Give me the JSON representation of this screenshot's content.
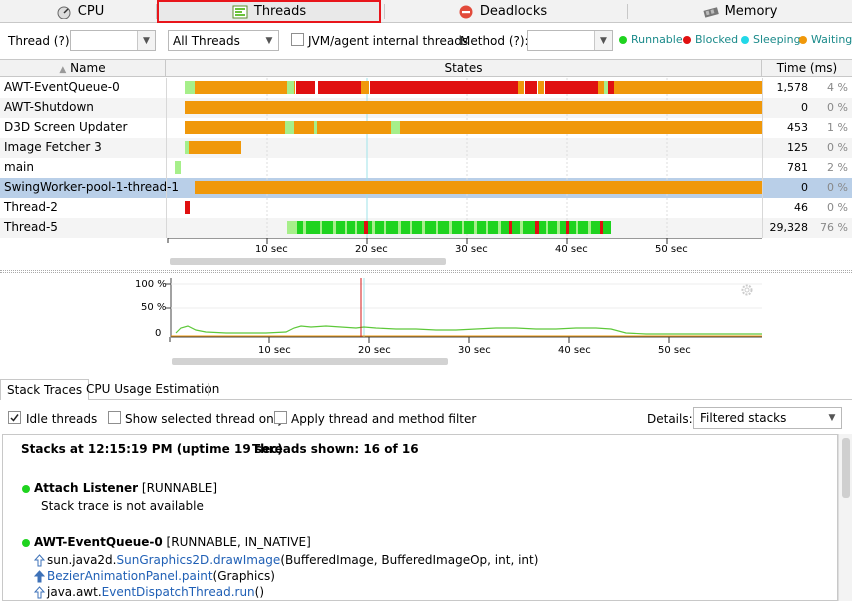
{
  "tabs": [
    {
      "label": "CPU",
      "icon": "cpu-gauge-icon"
    },
    {
      "label": "Threads",
      "icon": "threads-icon",
      "selected": true
    },
    {
      "label": "Deadlocks",
      "icon": "no-entry-icon"
    },
    {
      "label": "Memory",
      "icon": "memory-chip-icon"
    }
  ],
  "filters": {
    "thread_label": "Thread (?):",
    "thread_value": "",
    "scope_value": "All Threads",
    "internal_label": "JVM/agent internal threads",
    "method_label": "Method (?):",
    "method_value": ""
  },
  "legend": [
    {
      "label": "Runnable",
      "color": "#1fd31f"
    },
    {
      "label": "Blocked",
      "color": "#e01010"
    },
    {
      "label": "Sleeping",
      "color": "#22d8e8"
    },
    {
      "label": "Waiting",
      "color": "#f0980a"
    }
  ],
  "table": {
    "headers": {
      "name": "Name",
      "states": "States",
      "time": "Time (ms)"
    },
    "axis_labels": [
      "10 sec",
      "20 sec",
      "30 sec",
      "40 sec",
      "50 sec"
    ],
    "rows": [
      {
        "name": "AWT-EventQueue-0",
        "time": "1,578",
        "pct": "4 %"
      },
      {
        "name": "AWT-Shutdown",
        "time": "0",
        "pct": "0 %"
      },
      {
        "name": "D3D Screen Updater",
        "time": "453",
        "pct": "1 %"
      },
      {
        "name": "Image Fetcher 3",
        "time": "125",
        "pct": "0 %"
      },
      {
        "name": "main",
        "time": "781",
        "pct": "2 %"
      },
      {
        "name": "SwingWorker-pool-1-thread-1",
        "time": "0",
        "pct": "0 %",
        "selected": true
      },
      {
        "name": "Thread-2",
        "time": "46",
        "pct": "0 %"
      },
      {
        "name": "Thread-5",
        "time": "29,328",
        "pct": "76 %"
      }
    ]
  },
  "cpu_chart": {
    "y_labels": [
      "100 %",
      "50 %",
      "0"
    ],
    "x_labels": [
      "10 sec",
      "20 sec",
      "30 sec",
      "40 sec",
      "50 sec"
    ]
  },
  "bottom_tabs": [
    {
      "label": "Stack Traces",
      "selected": true
    },
    {
      "label": "CPU Usage Estimation"
    }
  ],
  "options": {
    "idle_label": "Idle threads",
    "idle_checked": true,
    "selected_only_label": "Show selected thread only",
    "apply_filter_label": "Apply thread and method filter",
    "details_label": "Details:",
    "details_value": "Filtered stacks"
  },
  "stacks": {
    "header_time": "Stacks at 12:15:19 PM (uptime 19 sec)",
    "header_shown": "Threads shown: 16 of 16",
    "threads": [
      {
        "name": "Attach Listener",
        "state": "[RUNNABLE]",
        "note": "Stack trace is not available",
        "frames": []
      },
      {
        "name": "AWT-EventQueue-0",
        "state": "[RUNNABLE, IN_NATIVE]",
        "frames": [
          {
            "pkg": "sun.java2d.",
            "cls": "SunGraphics2D.drawImage",
            "args": "(BufferedImage, BufferedImageOp, int, int)"
          },
          {
            "pkg": "",
            "cls": "BezierAnimationPanel.paint",
            "args": "(Graphics)"
          },
          {
            "pkg": "java.awt.",
            "cls": "EventDispatchThread.run",
            "args": "()"
          }
        ]
      }
    ]
  }
}
